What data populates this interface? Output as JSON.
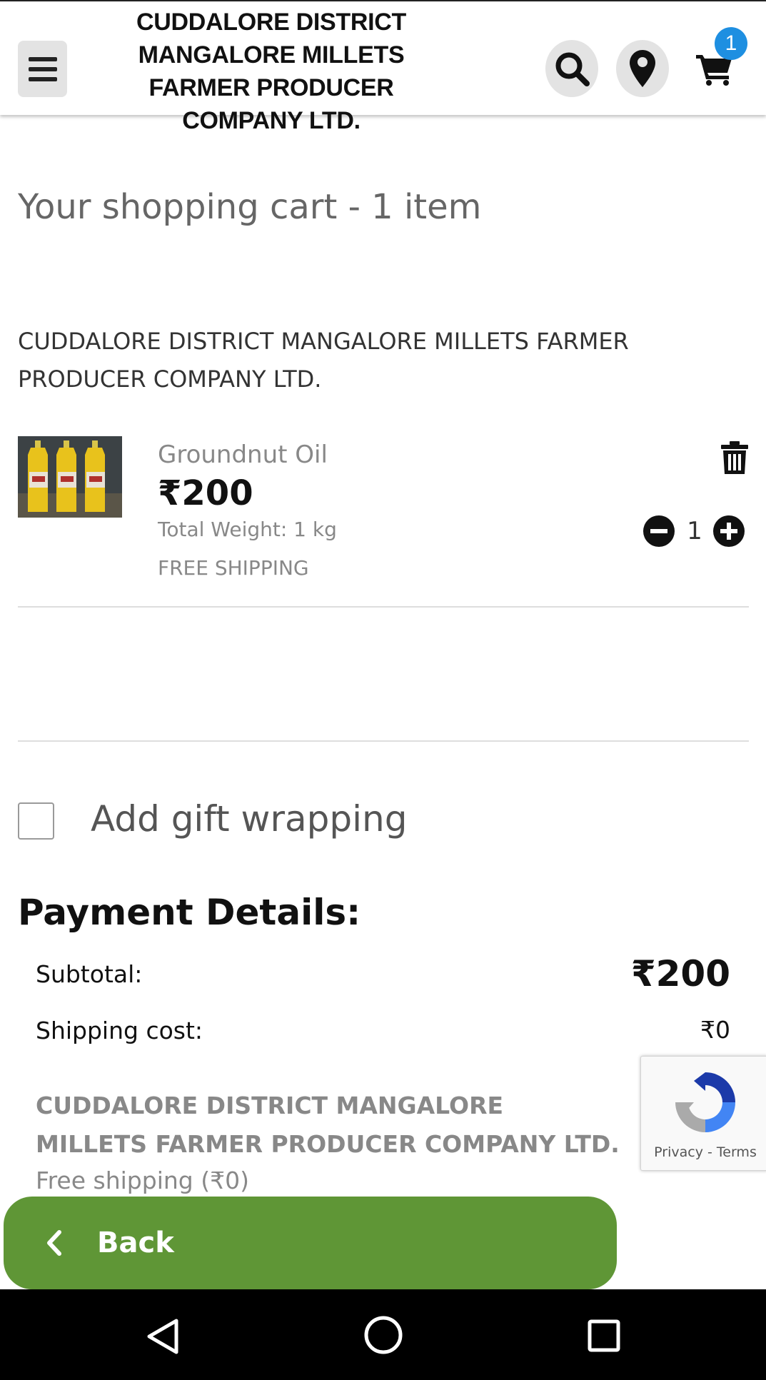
{
  "header": {
    "brand": "CUDDALORE DISTRICT MANGALORE MILLETS FARMER PRODUCER COMPANY LTD.",
    "cart_count": "1",
    "icons": [
      "menu-icon",
      "search-icon",
      "location-pin-icon",
      "cart-icon"
    ]
  },
  "cart": {
    "title": "Your shopping cart - 1 item",
    "seller": "CUDDALORE DISTRICT MANGALORE MILLETS FARMER PRODUCER COMPANY LTD.",
    "item": {
      "name": "Groundnut Oil",
      "price": "₹200",
      "weight": "Total Weight: 1 kg",
      "shipping": "FREE SHIPPING",
      "quantity": "1"
    }
  },
  "gift": {
    "label": "Add gift wrapping",
    "checked": false
  },
  "payment": {
    "title": "Payment Details:",
    "subtotal_label": "Subtotal:",
    "subtotal_value": "₹200",
    "shipping_label": "Shipping cost:",
    "shipping_value": "₹0",
    "seller": "CUDDALORE DISTRICT MANGALORE MILLETS FARMER PRODUCER COMPANY LTD.",
    "free_shipping": "Free shipping (₹0)"
  },
  "recaptcha": {
    "privacy": "Privacy",
    "separator": "-",
    "terms": "Terms"
  },
  "footer": {
    "back_label": "Back"
  },
  "colors": {
    "accent_green": "#5f9636",
    "badge_blue": "#1e8fe1"
  }
}
